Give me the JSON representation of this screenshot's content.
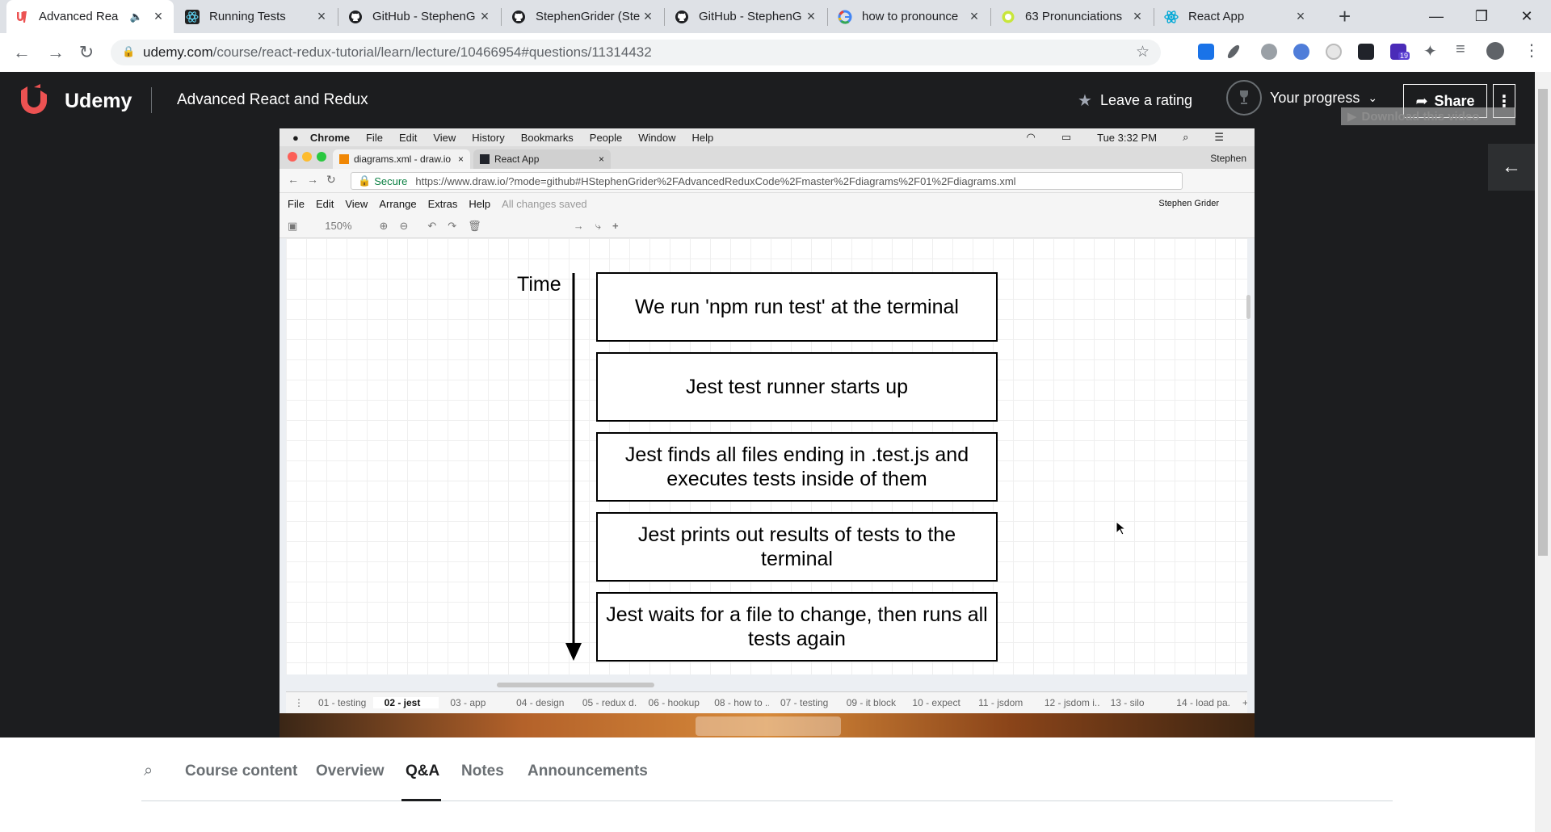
{
  "browser": {
    "tabs": [
      {
        "title": "Advanced Rea",
        "icon": "udemy-icon",
        "active": true
      },
      {
        "title": "Running Tests",
        "icon": "react-icon"
      },
      {
        "title": "GitHub - StephenG",
        "icon": "github-icon"
      },
      {
        "title": "StephenGrider (Ste",
        "icon": "github-icon"
      },
      {
        "title": "GitHub - StephenG",
        "icon": "github-icon"
      },
      {
        "title": "how to pronounce",
        "icon": "google-icon"
      },
      {
        "title": "63 Pronunciations",
        "icon": "pronunciation-icon"
      },
      {
        "title": "React App",
        "icon": "react-icon"
      }
    ],
    "url_host": "udemy.com",
    "url_path": "/course/react-redux-tutorial/learn/lecture/10466954#questions/11314432",
    "extension_badge": "19"
  },
  "udemy": {
    "logo": "Udemy",
    "course_title": "Advanced React and Redux",
    "leave_rating": "Leave a rating",
    "your_progress": "Your progress",
    "share": "Share",
    "download_video": "Download this video"
  },
  "video": {
    "mac_menu": [
      "Chrome",
      "File",
      "Edit",
      "View",
      "History",
      "Bookmarks",
      "People",
      "Window",
      "Help"
    ],
    "mac_clock": "Tue 3:32 PM",
    "chrome_tabs": [
      "diagrams.xml - draw.io",
      "React App"
    ],
    "chrome_user": "Stephen",
    "secure_label": "Secure",
    "drawio_url": "https://www.draw.io/?mode=github#HStephenGrider%2FAdvancedReduxCode%2Fmaster%2Fdiagrams%2F01%2Fdiagrams.xml",
    "drawio_menu": [
      "File",
      "Edit",
      "View",
      "Arrange",
      "Extras",
      "Help"
    ],
    "drawio_status": "All changes saved",
    "drawio_user": "Stephen Grider",
    "zoom": "150%",
    "diagram": {
      "time_label": "Time",
      "steps": [
        "We run 'npm run test' at the terminal",
        "Jest test runner starts up",
        "Jest finds all files ending in .test.js and executes tests inside of them",
        "Jest prints out results of tests to the terminal",
        "Jest waits for a file to change, then runs all tests again"
      ]
    },
    "pages": [
      "01 - testing",
      "02 - jest",
      "03 - app",
      "04 - design",
      "05 - redux d...",
      "06 - hookup",
      "08 - how to ...",
      "07 - testing",
      "09 - it block",
      "10 - expect",
      "11 - jsdom",
      "12 - jsdom i...",
      "13 - silo",
      "14 - load pa..."
    ],
    "current_page": "02 - jest"
  },
  "course_nav": {
    "tabs": [
      "Course content",
      "Overview",
      "Q&A",
      "Notes",
      "Announcements"
    ],
    "active": "Q&A"
  },
  "colors": {
    "udemy_dark": "#1c1d1f",
    "udemy_red": "#ec5252",
    "chrome_tabstrip": "#dee1e6"
  }
}
